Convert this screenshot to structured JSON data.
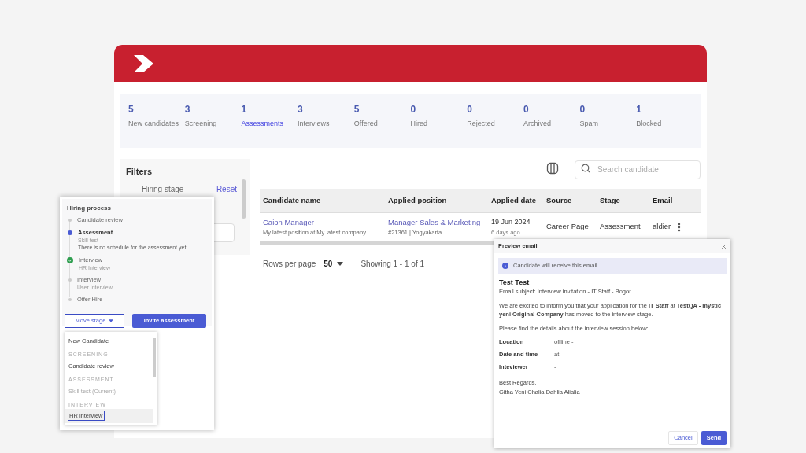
{
  "stats": [
    {
      "count": "5",
      "label": "New candidates",
      "selected": false
    },
    {
      "count": "3",
      "label": "Screening",
      "selected": false
    },
    {
      "count": "1",
      "label": "Assessments",
      "selected": true
    },
    {
      "count": "3",
      "label": "Interviews",
      "selected": false
    },
    {
      "count": "5",
      "label": "Offered",
      "selected": false
    },
    {
      "count": "0",
      "label": "Hired",
      "selected": false
    },
    {
      "count": "0",
      "label": "Rejected",
      "selected": false
    },
    {
      "count": "0",
      "label": "Archived",
      "selected": false
    },
    {
      "count": "0",
      "label": "Spam",
      "selected": false
    },
    {
      "count": "1",
      "label": "Blocked",
      "selected": false
    }
  ],
  "filters": {
    "title": "Filters",
    "section": "Hiring stage",
    "reset": "Reset"
  },
  "search": {
    "placeholder": "Search candidate"
  },
  "table": {
    "columns": [
      "Candidate name",
      "Applied position",
      "Applied date",
      "Source",
      "Stage",
      "Email"
    ],
    "rows": [
      {
        "name": "Caion Manager",
        "headline": "My latest position at My latest company",
        "position": "Manager Sales & Marketing",
        "position_meta": "#21361 | Yogyakarta",
        "date": "19 Jun 2024",
        "date_ago": "6 days ago",
        "source": "Career Page",
        "stage": "Assessment",
        "email": "aldier"
      }
    ]
  },
  "pagination": {
    "rows_label": "Rows per page",
    "rows_value": "50",
    "showing": "Showing 1 - 1 of 1"
  },
  "hiring_process": {
    "title": "Hiring process",
    "steps": [
      {
        "title": "Candidate review",
        "current": false,
        "completed": false
      },
      {
        "title": "Assessment",
        "subtitle": "Skill test",
        "note": "There is no schedule for the assessment yet",
        "current": true,
        "completed": false
      },
      {
        "title": "Interview",
        "subtitle": "HR Interview",
        "current": false,
        "completed": true
      },
      {
        "title": "Interview",
        "subtitle": "User Interview",
        "current": false,
        "completed": false
      },
      {
        "title": "Offer Hire",
        "current": false,
        "completed": false
      }
    ],
    "move_stage": "Move stage",
    "invite": "Invite assessment"
  },
  "stage_menu": [
    {
      "kind": "option",
      "label": "New Candidate",
      "disabled": false,
      "selected": false
    },
    {
      "kind": "heading",
      "label": "SCREENING"
    },
    {
      "kind": "option",
      "label": "Candidate review",
      "disabled": false,
      "selected": false
    },
    {
      "kind": "heading",
      "label": "ASSESSMENT"
    },
    {
      "kind": "option",
      "label": "Skill test (Current)",
      "disabled": true,
      "selected": false
    },
    {
      "kind": "heading",
      "label": "INTERVIEW"
    },
    {
      "kind": "option",
      "label": "HR interview",
      "disabled": false,
      "selected": true
    }
  ],
  "email": {
    "title": "Preview email",
    "notice": "Candidate will receive this email.",
    "recipient": "Test Test",
    "subject": "Email subject: Interview invitation - IT Staff - Bogor",
    "body": "We are excited to inform you that your application for the **IT Staff** at **TestQA - mystic yeni Original Company** has moved to the interview stage.",
    "details_intro": "Please find the details about the interview session below:",
    "details": [
      {
        "label": "Location",
        "value": "offline -"
      },
      {
        "label": "Date and time",
        "value": "at"
      },
      {
        "label": "Inteviewer",
        "value": "-"
      }
    ],
    "signoff": [
      "Best Regards,",
      "Githa Yeni Chalia Dahlia Alialia"
    ],
    "cancel": "Cancel",
    "send": "Send"
  }
}
